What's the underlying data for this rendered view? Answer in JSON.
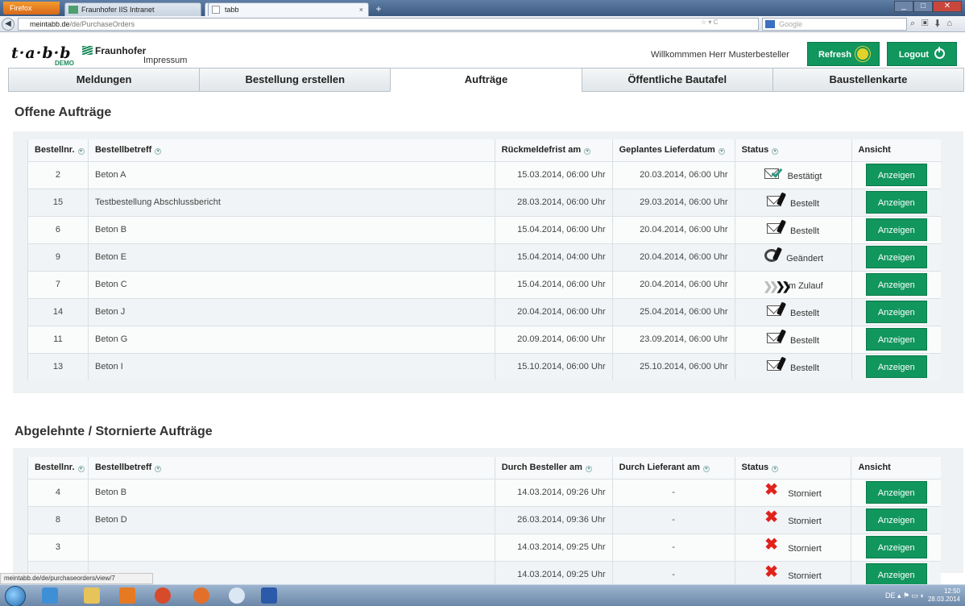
{
  "browser": {
    "menu_button": "Firefox",
    "tabs": [
      {
        "label": "Fraunhofer IIS Intranet"
      },
      {
        "label": "tabb"
      }
    ],
    "new_tab": "+",
    "url_domain": "meintabb.de",
    "url_path": "/de/PurchaseOrders",
    "search_placeholder": "Google",
    "status_url": "meintabb.de/de/purchaseorders/view/7"
  },
  "header": {
    "logo": "t·a·b·b",
    "logo_badge": "DEMO",
    "partner": "Fraunhofer",
    "impressum": "Impressum",
    "welcome": "Willkommmen Herr Musterbesteller",
    "refresh": "Refresh",
    "logout": "Logout"
  },
  "nav": {
    "tabs": [
      {
        "label": "Meldungen"
      },
      {
        "label": "Bestellung erstellen"
      },
      {
        "label": "Aufträge"
      },
      {
        "label": "Öffentliche Bautafel"
      },
      {
        "label": "Baustellenkarte"
      }
    ],
    "active": "Aufträge"
  },
  "open_orders": {
    "title": "Offene Aufträge",
    "columns": [
      "Bestellnr.",
      "Bestellbetreff",
      "Rückmeldefrist am",
      "Geplantes Lieferdatum",
      "Status",
      "Ansicht"
    ],
    "rows": [
      {
        "nr": "2",
        "subject": "Beton A",
        "deadline": "15.03.2014, 06:00 Uhr",
        "delivery": "20.03.2014, 06:00 Uhr",
        "status": "Bestätigt",
        "icon": "confirmed-icon",
        "action": "Anzeigen"
      },
      {
        "nr": "15",
        "subject": "Testbestellung Abschlussbericht",
        "deadline": "28.03.2014, 06:00 Uhr",
        "delivery": "29.03.2014, 06:00 Uhr",
        "status": "Bestellt",
        "icon": "ordered-icon",
        "action": "Anzeigen"
      },
      {
        "nr": "6",
        "subject": "Beton B",
        "deadline": "15.04.2014, 06:00 Uhr",
        "delivery": "20.04.2014, 06:00 Uhr",
        "status": "Bestellt",
        "icon": "ordered-icon",
        "action": "Anzeigen"
      },
      {
        "nr": "9",
        "subject": "Beton E",
        "deadline": "15.04.2014, 04:00 Uhr",
        "delivery": "20.04.2014, 06:00 Uhr",
        "status": "Geändert",
        "icon": "changed-icon",
        "action": "Anzeigen"
      },
      {
        "nr": "7",
        "subject": "Beton C",
        "deadline": "15.04.2014, 06:00 Uhr",
        "delivery": "20.04.2014, 06:00 Uhr",
        "status": "im Zulauf",
        "icon": "inflow-icon",
        "action": "Anzeigen"
      },
      {
        "nr": "14",
        "subject": "Beton J",
        "deadline": "20.04.2014, 06:00 Uhr",
        "delivery": "25.04.2014, 06:00 Uhr",
        "status": "Bestellt",
        "icon": "ordered-icon",
        "action": "Anzeigen"
      },
      {
        "nr": "11",
        "subject": "Beton G",
        "deadline": "20.09.2014, 06:00 Uhr",
        "delivery": "23.09.2014, 06:00 Uhr",
        "status": "Bestellt",
        "icon": "ordered-icon",
        "action": "Anzeigen"
      },
      {
        "nr": "13",
        "subject": "Beton I",
        "deadline": "15.10.2014, 06:00 Uhr",
        "delivery": "25.10.2014, 06:00 Uhr",
        "status": "Bestellt",
        "icon": "ordered-icon",
        "action": "Anzeigen"
      }
    ]
  },
  "cancelled_orders": {
    "title": "Abgelehnte / Stornierte Aufträge",
    "columns": [
      "Bestellnr.",
      "Bestellbetreff",
      "Durch Besteller am",
      "Durch Lieferant am",
      "Status",
      "Ansicht"
    ],
    "rows": [
      {
        "nr": "4",
        "subject": "Beton B",
        "by_orderer": "14.03.2014, 09:26 Uhr",
        "by_supplier": "-",
        "status": "Storniert",
        "action": "Anzeigen"
      },
      {
        "nr": "8",
        "subject": "Beton D",
        "by_orderer": "26.03.2014, 09:36 Uhr",
        "by_supplier": "-",
        "status": "Storniert",
        "action": "Anzeigen"
      },
      {
        "nr": "3",
        "subject": "",
        "by_orderer": "14.03.2014, 09:25 Uhr",
        "by_supplier": "-",
        "status": "Storniert",
        "action": "Anzeigen"
      },
      {
        "nr": "",
        "subject": "",
        "by_orderer": "14.03.2014, 09:25 Uhr",
        "by_supplier": "-",
        "status": "Storniert",
        "action": "Anzeigen"
      }
    ]
  },
  "taskbar": {
    "lang": "DE",
    "time": "12:50",
    "date": "28.03.2014"
  },
  "colors": {
    "accent": "#11965d",
    "cancel": "#e0231c",
    "confirm": "#2a9b83"
  }
}
